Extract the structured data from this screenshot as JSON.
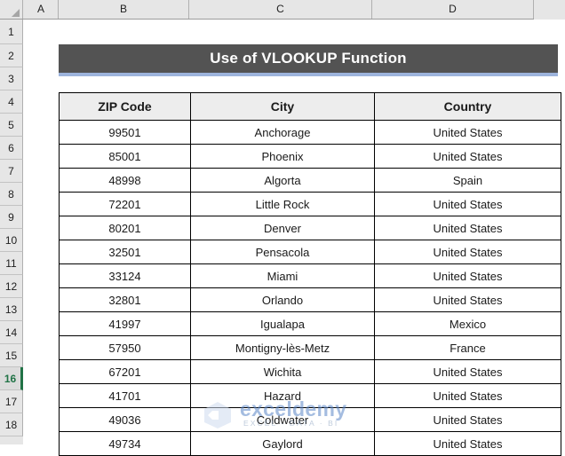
{
  "sheet": {
    "column_headers": [
      "A",
      "B",
      "C",
      "D"
    ],
    "row_headers": [
      "1",
      "2",
      "3",
      "4",
      "5",
      "6",
      "7",
      "8",
      "9",
      "10",
      "11",
      "12",
      "13",
      "14",
      "15",
      "16",
      "17",
      "18"
    ],
    "active_row": "16"
  },
  "title": {
    "text": "Use of VLOOKUP Function",
    "background_color": "#535353",
    "underline_color": "#9db4dc",
    "text_color": "#ffffff"
  },
  "table": {
    "headers": [
      "ZIP Code",
      "City",
      "Country"
    ],
    "rows": [
      [
        "99501",
        "Anchorage",
        "United States"
      ],
      [
        "85001",
        "Phoenix",
        "United States"
      ],
      [
        "48998",
        "Algorta",
        "Spain"
      ],
      [
        "72201",
        "Little Rock",
        "United States"
      ],
      [
        "80201",
        "Denver",
        "United States"
      ],
      [
        "32501",
        "Pensacola",
        "United States"
      ],
      [
        "33124",
        "Miami",
        "United States"
      ],
      [
        "32801",
        "Orlando",
        "United States"
      ],
      [
        "41997",
        "Igualapa",
        "Mexico"
      ],
      [
        "57950",
        "Montigny-lès-Metz",
        "France"
      ],
      [
        "67201",
        "Wichita",
        "United States"
      ],
      [
        "41701",
        "Hazard",
        "United States"
      ],
      [
        "49036",
        "Coldwater",
        "United States"
      ],
      [
        "49734",
        "Gaylord",
        "United States"
      ]
    ],
    "header_background": "#ededed",
    "border_color": "#000000"
  },
  "watermark": {
    "name": "exceldemy",
    "tagline": "EXCEL · DATA · BI",
    "logo_icon": "hexagon-logo-icon",
    "color": "#5b87c7"
  }
}
